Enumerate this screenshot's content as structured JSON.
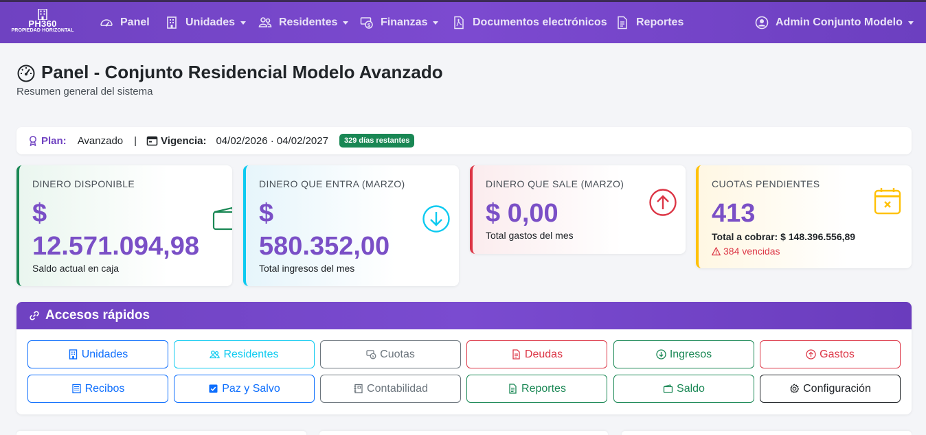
{
  "brand": {
    "name": "PH360",
    "subtitle": "PROPIEDAD HORIZONTAL"
  },
  "nav": {
    "items": [
      {
        "label": "Panel",
        "icon": "speedometer-icon"
      },
      {
        "label": "Unidades",
        "icon": "building-icon"
      },
      {
        "label": "Residentes",
        "icon": "people-icon"
      },
      {
        "label": "Finanzas",
        "icon": "cash-coin-icon"
      },
      {
        "label": "Documentos electrónicos",
        "icon": "file-pdf-icon"
      },
      {
        "label": "Reportes",
        "icon": "file-text-icon"
      }
    ],
    "user": {
      "label": "Admin Conjunto Modelo",
      "icon": "person-circle-icon"
    }
  },
  "header": {
    "title": "Panel - Conjunto Residencial Modelo Avanzado",
    "subtitle": "Resumen general del sistema"
  },
  "plan": {
    "plan_label": "Plan:",
    "plan_value": "Avanzado",
    "separator": "|",
    "vigencia_label": "Vigencia:",
    "vigencia_value": "04/02/2026 · 04/02/2027",
    "days_badge": "329 días restantes"
  },
  "cards": {
    "disponible": {
      "title": "DINERO DISPONIBLE",
      "currency": "$",
      "amount": "12.571.094,98",
      "footer": "Saldo actual en caja",
      "accent": "#198754"
    },
    "entra": {
      "title": "DINERO QUE ENTRA (MARZO)",
      "currency": "$",
      "amount": "580.352,00",
      "footer": "Total ingresos del mes",
      "accent": "#0dcaf0"
    },
    "sale": {
      "title": "DINERO QUE SALE (MARZO)",
      "value": "$ 0,00",
      "footer": "Total gastos del mes",
      "accent": "#dc3545"
    },
    "cuotas": {
      "title": "CUOTAS PENDIENTES",
      "value": "413",
      "total": "Total a cobrar: $ 148.396.556,89",
      "vencidas": "384 vencidas",
      "accent": "#ffc107"
    }
  },
  "quick": {
    "title": "Accesos rápidos",
    "buttons": [
      {
        "label": "Unidades",
        "icon": "building-icon"
      },
      {
        "label": "Residentes",
        "icon": "people-icon"
      },
      {
        "label": "Cuotas",
        "icon": "cash-coin-icon"
      },
      {
        "label": "Deudas",
        "icon": "file-text-icon"
      },
      {
        "label": "Ingresos",
        "icon": "arrow-down-circle-icon"
      },
      {
        "label": "Gastos",
        "icon": "arrow-up-circle-icon"
      },
      {
        "label": "Recibos",
        "icon": "receipt-icon"
      },
      {
        "label": "Paz y Salvo",
        "icon": "check-square-icon"
      },
      {
        "label": "Contabilidad",
        "icon": "journal-icon"
      },
      {
        "label": "Reportes",
        "icon": "file-text-icon"
      },
      {
        "label": "Saldo",
        "icon": "wallet-icon"
      },
      {
        "label": "Configuración",
        "icon": "gear-icon"
      }
    ]
  }
}
